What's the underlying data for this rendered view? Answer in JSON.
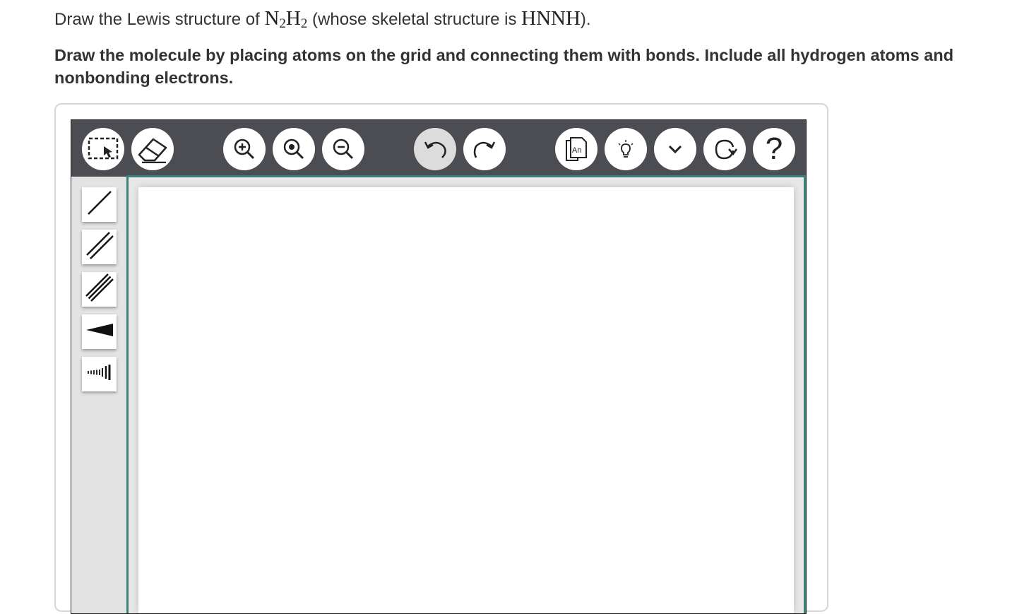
{
  "question": {
    "line1_prefix": "Draw the Lewis structure of ",
    "formula_n": "N",
    "formula_n_sub": "2",
    "formula_h": "H",
    "formula_h_sub": "2",
    "line1_middle": " (whose skeletal structure is ",
    "skeleton": "HNNH",
    "line1_suffix": ").",
    "instruction_line1": "Draw the molecule by placing atoms on the grid and connecting them with bonds. Include all hydrogen atoms and",
    "instruction_line2": "nonbonding electrons."
  },
  "toolbar": {
    "buttons": [
      {
        "id": "select",
        "icon": "selection-arrow-icon"
      },
      {
        "id": "erase",
        "icon": "eraser-icon"
      },
      {
        "id": "zoom-in",
        "icon": "zoom-in-icon"
      },
      {
        "id": "zoom-reset",
        "icon": "zoom-reset-icon"
      },
      {
        "id": "zoom-out",
        "icon": "zoom-out-icon"
      },
      {
        "id": "undo",
        "icon": "undo-icon",
        "disabled": true
      },
      {
        "id": "redo",
        "icon": "redo-icon"
      },
      {
        "id": "template",
        "icon": "template-icon",
        "label": "An"
      },
      {
        "id": "hint",
        "icon": "lightbulb-icon"
      },
      {
        "id": "more",
        "icon": "chevron-down-icon"
      },
      {
        "id": "reset",
        "icon": "reset-icon"
      },
      {
        "id": "help",
        "icon": "help-icon",
        "label": "?"
      }
    ]
  },
  "bond_tools": [
    {
      "id": "single",
      "icon": "single-bond-icon"
    },
    {
      "id": "double",
      "icon": "double-bond-icon"
    },
    {
      "id": "triple",
      "icon": "triple-bond-icon"
    },
    {
      "id": "wedge",
      "icon": "wedge-bond-icon"
    },
    {
      "id": "hash",
      "icon": "hash-bond-icon"
    }
  ],
  "colors": {
    "toolbar_bg": "#4c4d52",
    "canvas_border": "#3a8080",
    "side_bg": "#e3e3e3"
  }
}
